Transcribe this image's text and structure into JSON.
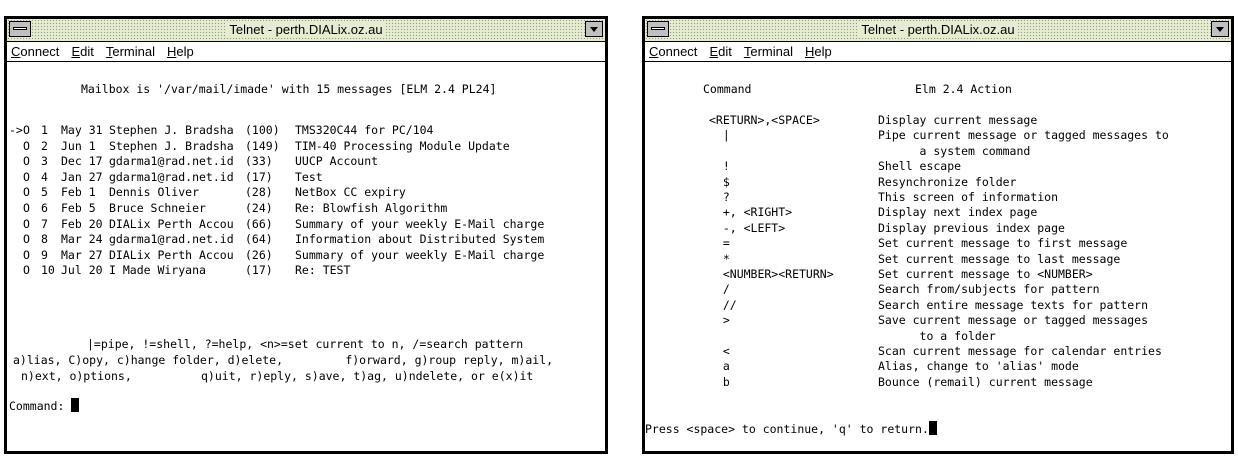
{
  "left_window": {
    "title": "Telnet - perth.DIALix.oz.au",
    "menu": [
      {
        "acc": "C",
        "rest": "onnect"
      },
      {
        "acc": "E",
        "rest": "dit"
      },
      {
        "acc": "T",
        "rest": "erminal"
      },
      {
        "acc": "H",
        "rest": "elp"
      }
    ],
    "header": "Mailbox is '/var/mail/imade' with 15 messages [ELM 2.4 PL24]",
    "messages": [
      {
        "marker": "->",
        "status": "O",
        "num": "1",
        "date": "May 31",
        "from": "Stephen J. Bradsha",
        "size": "(100)",
        "subject": "TMS320C44 for PC/104"
      },
      {
        "marker": "",
        "status": "O",
        "num": "2",
        "date": "Jun 1",
        "from": "Stephen J. Bradsha",
        "size": "(149)",
        "subject": "TIM-40 Processing Module Update"
      },
      {
        "marker": "",
        "status": "O",
        "num": "3",
        "date": "Dec 17",
        "from": "gdarma1@rad.net.id",
        "size": "(33)",
        "subject": "UUCP Account"
      },
      {
        "marker": "",
        "status": "O",
        "num": "4",
        "date": "Jan 27",
        "from": "gdarma1@rad.net.id",
        "size": "(17)",
        "subject": "Test"
      },
      {
        "marker": "",
        "status": "O",
        "num": "5",
        "date": "Feb 1",
        "from": "Dennis Oliver",
        "size": "(28)",
        "subject": "NetBox CC expiry"
      },
      {
        "marker": "",
        "status": "O",
        "num": "6",
        "date": "Feb 5",
        "from": "Bruce Schneier",
        "size": "(24)",
        "subject": "Re: Blowfish Algorithm"
      },
      {
        "marker": "",
        "status": "O",
        "num": "7",
        "date": "Feb 20",
        "from": "DIALix Perth Accou",
        "size": "(66)",
        "subject": "Summary of your weekly E-Mail charge"
      },
      {
        "marker": "",
        "status": "O",
        "num": "8",
        "date": "Mar 24",
        "from": "gdarma1@rad.net.id",
        "size": "(64)",
        "subject": "Information about Distributed System"
      },
      {
        "marker": "",
        "status": "O",
        "num": "9",
        "date": "Mar 27",
        "from": "DIALix Perth Accou",
        "size": "(26)",
        "subject": "Summary of your weekly E-Mail charge"
      },
      {
        "marker": "",
        "status": "O",
        "num": "10",
        "date": "Jul 20",
        "from": "I Made Wiryana",
        "size": "(17)",
        "subject": "Re: TEST"
      }
    ],
    "help_lines": [
      "|=pipe, !=shell, ?=help, <n>=set current to n, /=search pattern",
      "a)lias, C)opy, c)hange folder, d)elete,         f)orward, g)roup reply, m)ail,",
      "n)ext, o)ptions,          q)uit, r)eply, s)ave, t)ag, u)ndelete, or e(x)it"
    ],
    "prompt": "Command: "
  },
  "right_window": {
    "title": "Telnet - perth.DIALix.oz.au",
    "menu": [
      {
        "acc": "C",
        "rest": "onnect"
      },
      {
        "acc": "E",
        "rest": "dit"
      },
      {
        "acc": "T",
        "rest": "erminal"
      },
      {
        "acc": "H",
        "rest": "elp"
      }
    ],
    "col_command": "Command",
    "col_action": "Elm 2.4 Action",
    "commands": [
      {
        "key": "<RETURN>,<SPACE>",
        "action": "Display current message"
      },
      {
        "key": "  |",
        "action": "Pipe current message or tagged messages to"
      },
      {
        "key": "",
        "action": "      a system command"
      },
      {
        "key": "  !",
        "action": "Shell escape"
      },
      {
        "key": "  $",
        "action": "Resynchronize folder"
      },
      {
        "key": "  ?",
        "action": "This screen of information"
      },
      {
        "key": "  +, <RIGHT>",
        "action": "Display next index page"
      },
      {
        "key": "  -, <LEFT>",
        "action": "Display previous index page"
      },
      {
        "key": "  =",
        "action": "Set current message to first message"
      },
      {
        "key": "  *",
        "action": "Set current message to last message"
      },
      {
        "key": "  <NUMBER><RETURN>",
        "action": "Set current message to <NUMBER>"
      },
      {
        "key": "  /",
        "action": "Search from/subjects for pattern"
      },
      {
        "key": "  //",
        "action": "Search entire message texts for pattern"
      },
      {
        "key": "  >",
        "action": "Save current message or tagged messages"
      },
      {
        "key": "",
        "action": "      to a folder"
      },
      {
        "key": "  <",
        "action": "Scan current message for calendar entries"
      },
      {
        "key": "  a",
        "action": "Alias, change to 'alias' mode"
      },
      {
        "key": "  b",
        "action": "Bounce (remail) current message"
      }
    ],
    "footer": "Press <space> to continue, 'q' to return."
  }
}
